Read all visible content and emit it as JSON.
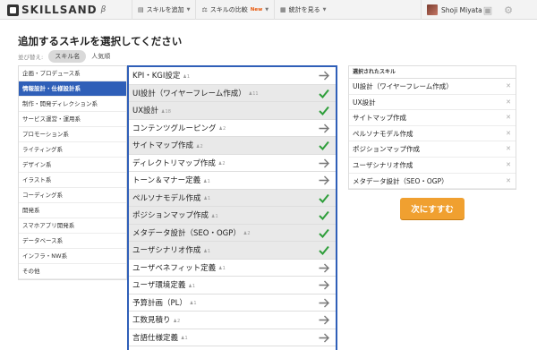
{
  "app": {
    "logo": "SKILLSAND",
    "beta": "β"
  },
  "nav": [
    {
      "label": "スキルを追加",
      "icon": "▤",
      "icon_name": "list-icon",
      "new": ""
    },
    {
      "label": "スキルの比較",
      "icon": "⚖",
      "icon_name": "scale-icon",
      "new": "New"
    },
    {
      "label": "統計を見る",
      "icon": "▦",
      "icon_name": "bar-chart-icon",
      "new": ""
    }
  ],
  "user": {
    "name": "Shoji Miyata"
  },
  "page": {
    "title": "追加するスキルを選択してください",
    "sort_label": "並び替え:",
    "sort_by_name": "スキル名",
    "sort_by_popularity": "人気順"
  },
  "categories": [
    {
      "label": "企画・プロデュース系",
      "active": false
    },
    {
      "label": "情報設計・仕様設計系",
      "active": true
    },
    {
      "label": "制作・開発ディレクション系",
      "active": false
    },
    {
      "label": "サービス運営・運用系",
      "active": false
    },
    {
      "label": "プロモーション系",
      "active": false
    },
    {
      "label": "ライティング系",
      "active": false
    },
    {
      "label": "デザイン系",
      "active": false
    },
    {
      "label": "イラスト系",
      "active": false
    },
    {
      "label": "コーディング系",
      "active": false
    },
    {
      "label": "開発系",
      "active": false
    },
    {
      "label": "スマホアプリ開発系",
      "active": false
    },
    {
      "label": "データベース系",
      "active": false
    },
    {
      "label": "インフラ・NW系",
      "active": false
    },
    {
      "label": "その他",
      "active": false
    }
  ],
  "skills": [
    {
      "name": "KPI・KGI設定",
      "count": "1",
      "selected": false
    },
    {
      "name": "UI設計（ワイヤーフレーム作成）",
      "count": "11",
      "selected": true
    },
    {
      "name": "UX設計",
      "count": "18",
      "selected": true
    },
    {
      "name": "コンテンツグルーピング",
      "count": "2",
      "selected": false
    },
    {
      "name": "サイトマップ作成",
      "count": "2",
      "selected": true
    },
    {
      "name": "ディレクトリマップ作成",
      "count": "2",
      "selected": false
    },
    {
      "name": "トーン＆マナー定義",
      "count": "1",
      "selected": false
    },
    {
      "name": "ペルソナモデル作成",
      "count": "1",
      "selected": true
    },
    {
      "name": "ポジションマップ作成",
      "count": "1",
      "selected": true
    },
    {
      "name": "メタデータ設計（SEO・OGP）",
      "count": "2",
      "selected": true
    },
    {
      "name": "ユーザシナリオ作成",
      "count": "1",
      "selected": true
    },
    {
      "name": "ユーザベネフィット定義",
      "count": "1",
      "selected": false
    },
    {
      "name": "ユーザ環境定義",
      "count": "1",
      "selected": false
    },
    {
      "name": "予算計画（PL）",
      "count": "1",
      "selected": false
    },
    {
      "name": "工数見積り",
      "count": "2",
      "selected": false
    },
    {
      "name": "言語仕様定義",
      "count": "1",
      "selected": false
    }
  ],
  "selected_panel": {
    "heading": "選択されたスキル",
    "items": [
      "UI設計（ワイヤーフレーム作成）",
      "UX設計",
      "サイトマップ作成",
      "ペルソナモデル作成",
      "ポジションマップ作成",
      "ユーザシナリオ作成",
      "メタデータ設計（SEO・OGP）"
    ],
    "remove_glyph": "✕"
  },
  "next_button": "次にすすむ",
  "colors": {
    "accent_blue": "#2f5fb8",
    "check_green": "#2e9e3a",
    "button_orange": "#f0a030"
  }
}
